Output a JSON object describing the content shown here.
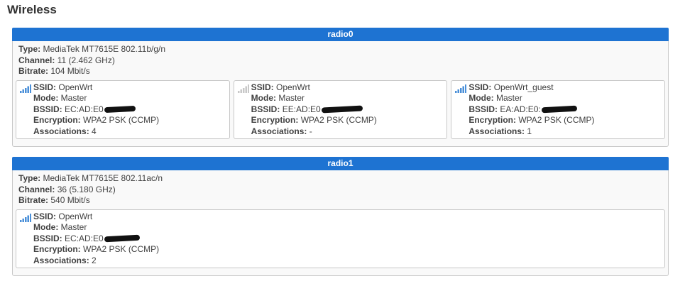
{
  "page": {
    "title": "Wireless"
  },
  "labels": {
    "type": "Type:",
    "channel": "Channel:",
    "bitrate": "Bitrate:",
    "ssid": "SSID:",
    "mode": "Mode:",
    "bssid": "BSSID:",
    "encryption": "Encryption:",
    "associations": "Associations:"
  },
  "radios": [
    {
      "name": "radio0",
      "type": "MediaTek MT7615E 802.11b/g/n",
      "channel": "11 (2.462 GHz)",
      "bitrate": "104 Mbit/s",
      "networks": [
        {
          "ssid": "OpenWrt",
          "mode": "Master",
          "bssid": "EC:AD:E0",
          "encryption": "WPA2 PSK (CCMP)",
          "associations": "4",
          "signal_icon": "signal-strong-icon"
        },
        {
          "ssid": "OpenWrt",
          "mode": "Master",
          "bssid": "EE:AD:E0",
          "encryption": "WPA2 PSK (CCMP)",
          "associations": "-",
          "signal_icon": "signal-none-icon"
        },
        {
          "ssid": "OpenWrt_guest",
          "mode": "Master",
          "bssid": "EA:AD:E0:",
          "encryption": "WPA2 PSK (CCMP)",
          "associations": "1",
          "signal_icon": "signal-strong-icon"
        }
      ]
    },
    {
      "name": "radio1",
      "type": "MediaTek MT7615E 802.11ac/n",
      "channel": "36 (5.180 GHz)",
      "bitrate": "540 Mbit/s",
      "networks": [
        {
          "ssid": "OpenWrt",
          "mode": "Master",
          "bssid": "EC:AD:E0",
          "encryption": "WPA2 PSK (CCMP)",
          "associations": "2",
          "signal_icon": "signal-strong-icon"
        }
      ]
    }
  ],
  "colors": {
    "header_bg": "#1e73d2",
    "signal_active": "#4a8fd8",
    "signal_inactive": "#c8c8c8"
  }
}
